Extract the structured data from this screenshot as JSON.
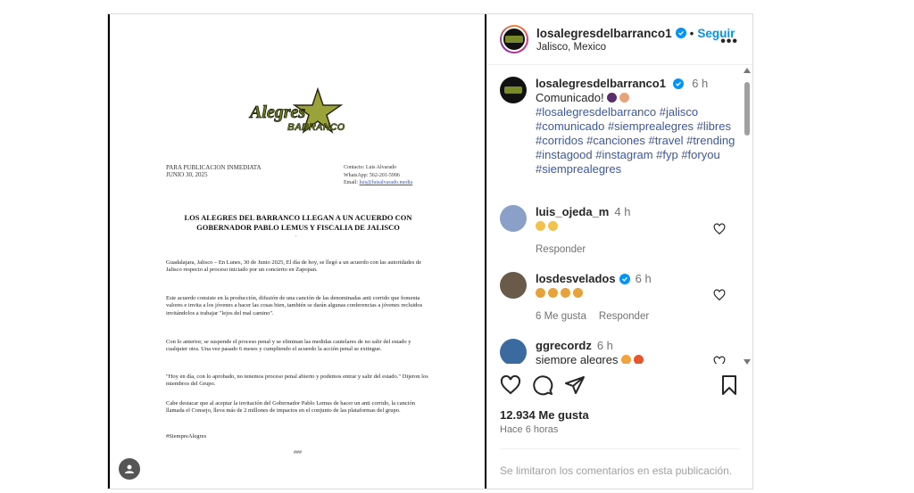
{
  "document": {
    "logo_text": "Alegres BARRANCO",
    "header_left": [
      "PARA PUBLICACION INMEDIATA",
      "JUNIO 30, 2025"
    ],
    "header_right": {
      "contact": "Contacto: Luis Alvarado",
      "whatsapp": "WhatsApp: 562-201-5996",
      "email_label": "Email:",
      "email": "luis@luisalvarado.media"
    },
    "title": "LOS ALEGRES DEL BARRANCO LLEGAN A UN ACUERDO CON GOBERNADOR PABLO LEMUS Y FISCALIA DE JALISCO",
    "paragraphs": [
      "Guadalajara, Jalisco – En Lunes, 30 de Junio 2025, El día de hoy, se llegó a un acuerdo con las autoridades de Jalisco respecto al proceso iniciado por un concierto en Zapopan.",
      "Este acuerdo consiste en la producción, difusión de una canción de las denominadas anti corrido que fomenta valores e invita a los jóvenes a hacer las cosas bien, también se darán algunas conferencias a jóvenes recluidos invitándolos a trabajar \"lejos del mal camino\".",
      "Con lo anterior, se suspende el proceso penal y se eliminan las medidas cautelares de no salir del estado y cualquier otra. Una vez pasado 6 meses y cumpliendo el acuerdo la acción penal se extingue.",
      "\"Hoy en día, con lo aprobado, no tenemos proceso penal abierto y podemos entrar y salir del estado.\" Dijeron los miembros del Grupo.",
      "Cabe destacar que al aceptar la invitación del Gobernador Pablo Lemus de hacer un anti corrido, la canción llamada el Consejo, lleva más de 2 millones de impactos en el conjunto de las plataformas del grupo.",
      "#SiempreAlegres"
    ],
    "end_mark": "###"
  },
  "header": {
    "username": "losalegresdelbarranco1",
    "separator": "•",
    "follow": "Seguir",
    "location": "Jalisco, Mexico",
    "more": "•••"
  },
  "caption": {
    "username": "losalegresdelbarranco1",
    "time": "6 h",
    "text": "Comunicado!",
    "hashtags": "#losalegresdelbarranco #jalisco #comunicado #siemprealegres #libres #corridos #canciones #travel #trending #instagood #instagram #fyp #foryou #siemprealegres"
  },
  "comments": [
    {
      "username": "luis_ojeda_m",
      "time": "4 h",
      "text": "",
      "likes": "",
      "reply": "Responder"
    },
    {
      "username": "losdesvelados",
      "time": "6 h",
      "text": "",
      "likes": "6 Me gusta",
      "reply": "Responder"
    },
    {
      "username": "ggrecordz",
      "time": "6 h",
      "text": "siempre alegres",
      "likes": "",
      "reply": ""
    }
  ],
  "footer": {
    "likes": "12.934 Me gusta",
    "time_ago": "Hace 6 horas",
    "comments_limited": "Se limitaron los comentarios en esta publicación."
  },
  "colors": {
    "accent": "#0095f6",
    "hashtag": "#3b57a8",
    "muted": "#737373"
  }
}
